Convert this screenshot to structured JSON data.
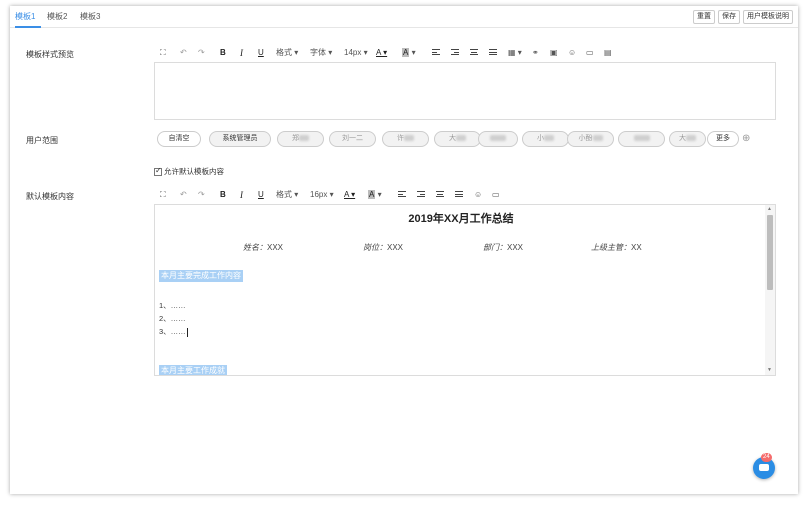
{
  "tabs": [
    {
      "label": "模板1",
      "active": true
    },
    {
      "label": "模板2",
      "active": false
    },
    {
      "label": "模板3",
      "active": false
    }
  ],
  "top_buttons": {
    "reset": "重置",
    "save": "保存",
    "manual": "用户模板说明"
  },
  "labels": {
    "preview": "模板样式预览",
    "user_scope": "用户范围",
    "default_content": "默认模板内容"
  },
  "toolbar1": {
    "format": "格式",
    "font": "字体",
    "size": "14px"
  },
  "toolbar2": {
    "format": "格式",
    "size": "16px"
  },
  "chips": [
    {
      "label": "自清空",
      "blurred": false
    },
    {
      "label": "系统管理员",
      "blurred": false
    },
    {
      "label": "郑",
      "blurred": true
    },
    {
      "label": "刘一二",
      "blurred": true
    },
    {
      "label": "许",
      "blurred": true
    },
    {
      "label": "大",
      "blurred": true
    },
    {
      "label": "",
      "blurred": true
    },
    {
      "label": "小",
      "blurred": true
    },
    {
      "label": "小酚",
      "blurred": true
    },
    {
      "label": "",
      "blurred": true
    },
    {
      "label": "大",
      "blurred": true
    }
  ],
  "more_label": "更多",
  "add_icon": "⊕",
  "allow_default": {
    "label": "允许默认模板内容",
    "checked": true
  },
  "doc": {
    "title": "2019年XX月工作总结",
    "fields": [
      {
        "label": "姓名：",
        "value": "XXX"
      },
      {
        "label": "岗位：",
        "value": "XXX"
      },
      {
        "label": "部门：",
        "value": "XXX"
      },
      {
        "label": "上级主管：",
        "value": "XX"
      }
    ],
    "section1": "本月主要完成工作内容",
    "items": [
      "1、……",
      "2、……",
      "3、……"
    ],
    "section2": "本月主要工作成就"
  },
  "chat_badge": "24",
  "colors": {
    "accent": "#3a8ee6",
    "highlight": "#a9d0f5",
    "chat": "#2b8de4",
    "badge": "#f56c6c"
  }
}
